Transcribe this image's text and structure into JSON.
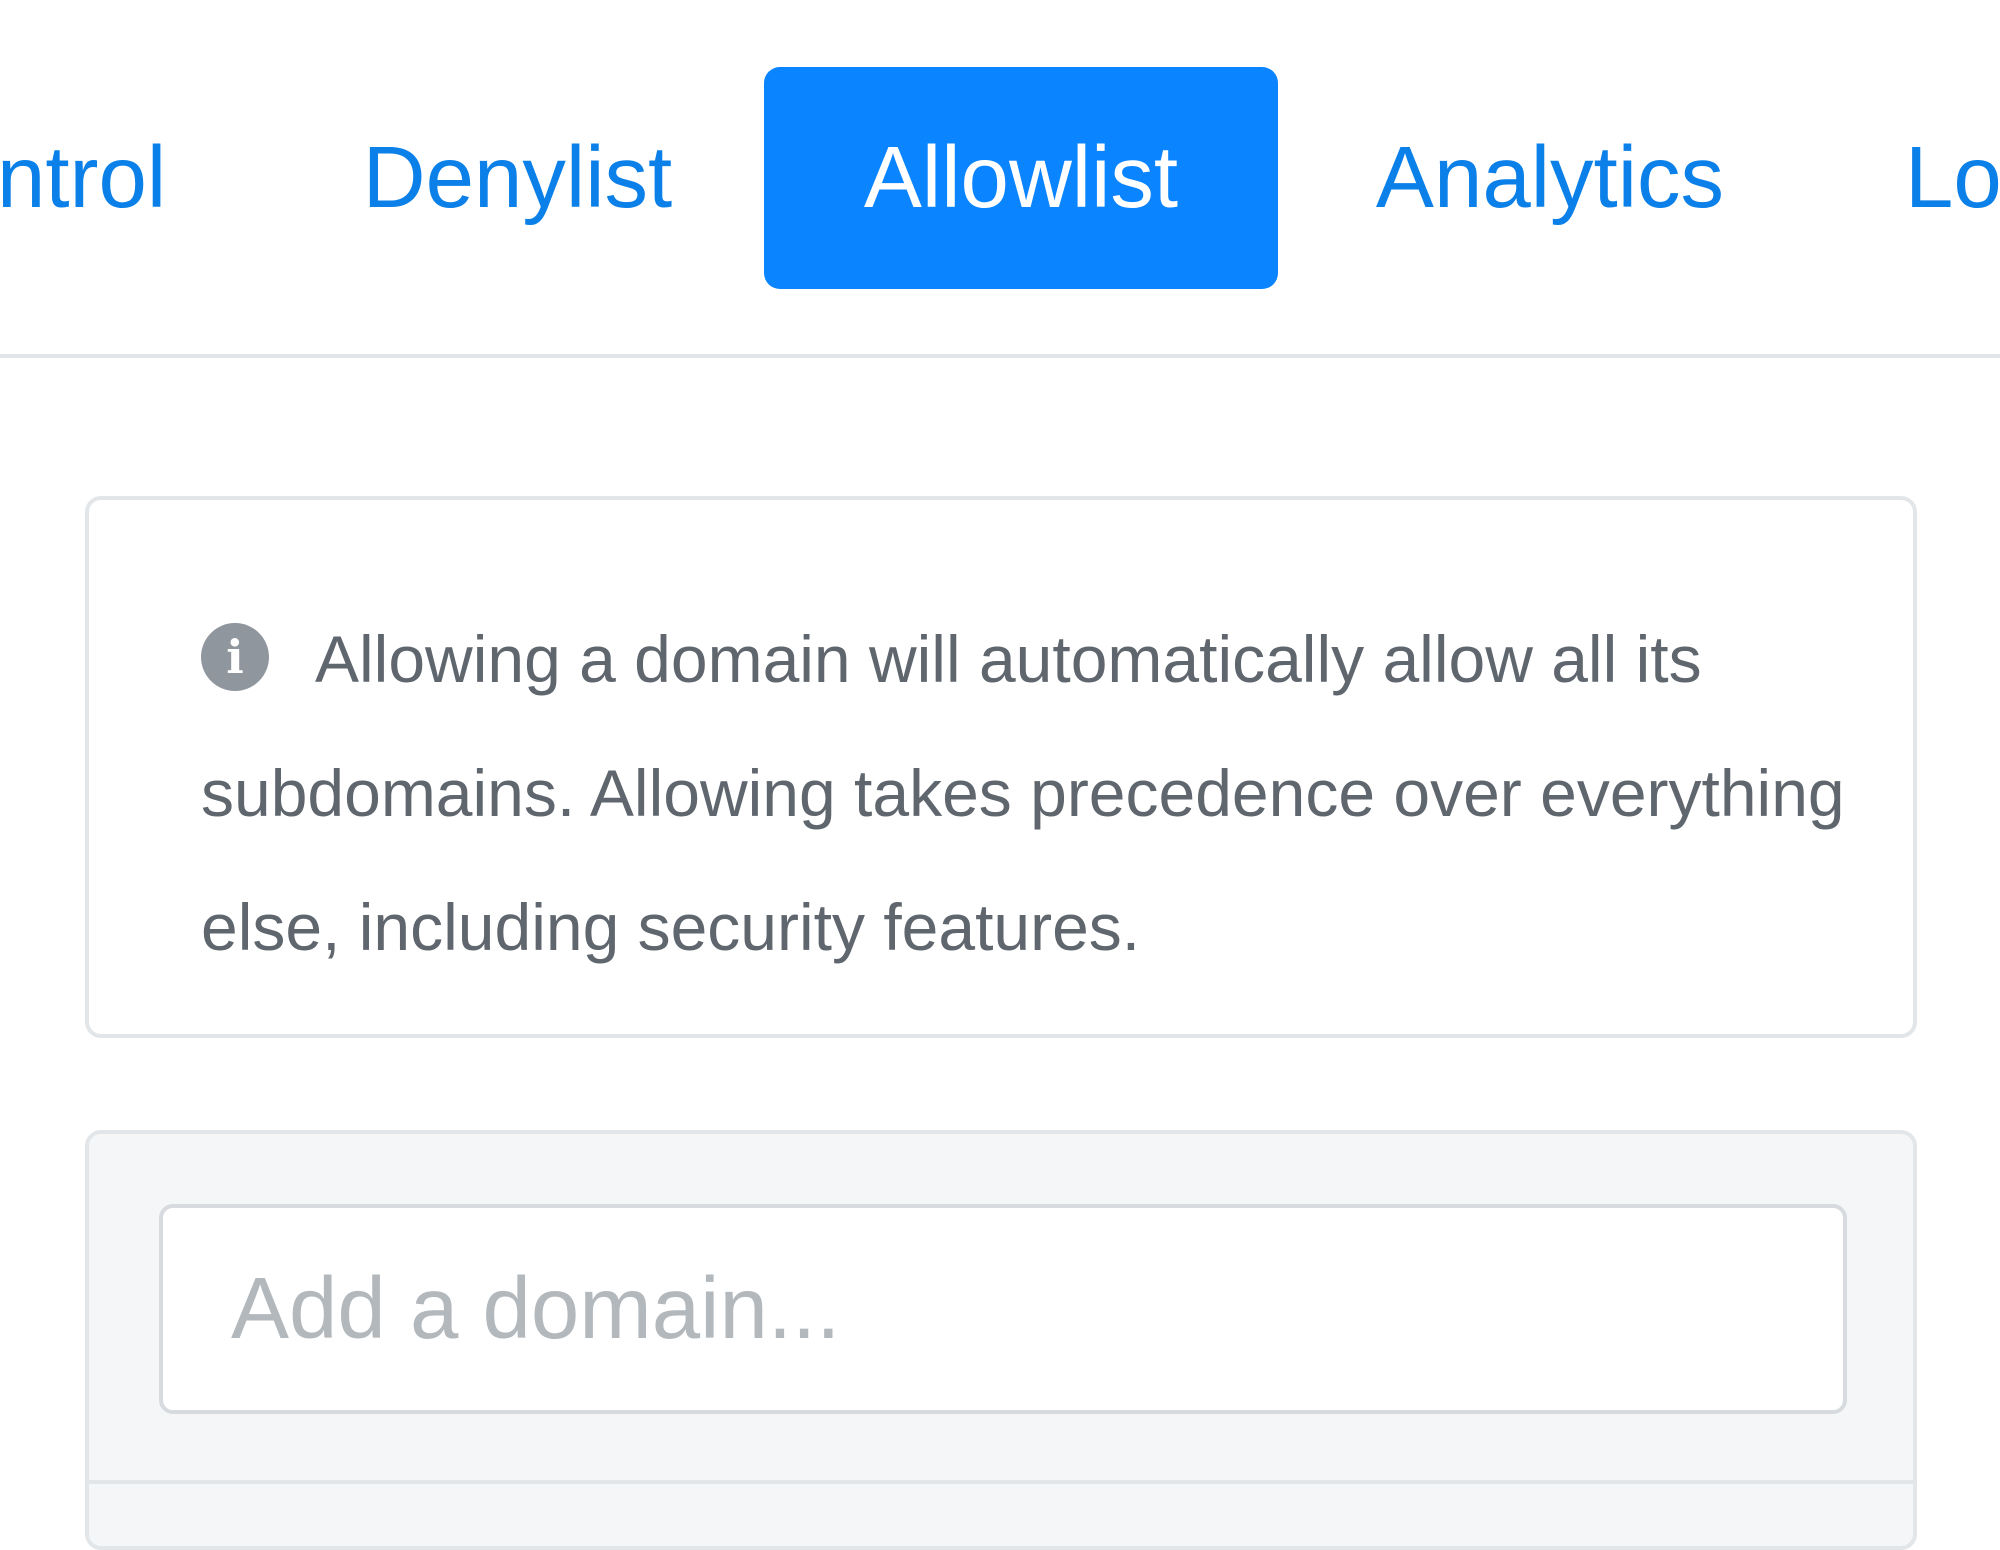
{
  "tabs": {
    "control": "ntrol",
    "denylist": "Denylist",
    "allowlist": "Allowlist",
    "analytics": "Analytics",
    "logs": "Lo"
  },
  "active_tab": "Allowlist",
  "info": {
    "icon": "info-circle-icon",
    "text": "Allowing a domain will automatically allow all its subdomains. Allowing takes precedence over everything else, including security features."
  },
  "add_domain": {
    "value": "",
    "placeholder": "Add a domain..."
  },
  "colors": {
    "accent": "#0a84ff",
    "tab_text": "#0b80e8",
    "body_text": "#5f666e",
    "border": "#e3e6e9"
  }
}
